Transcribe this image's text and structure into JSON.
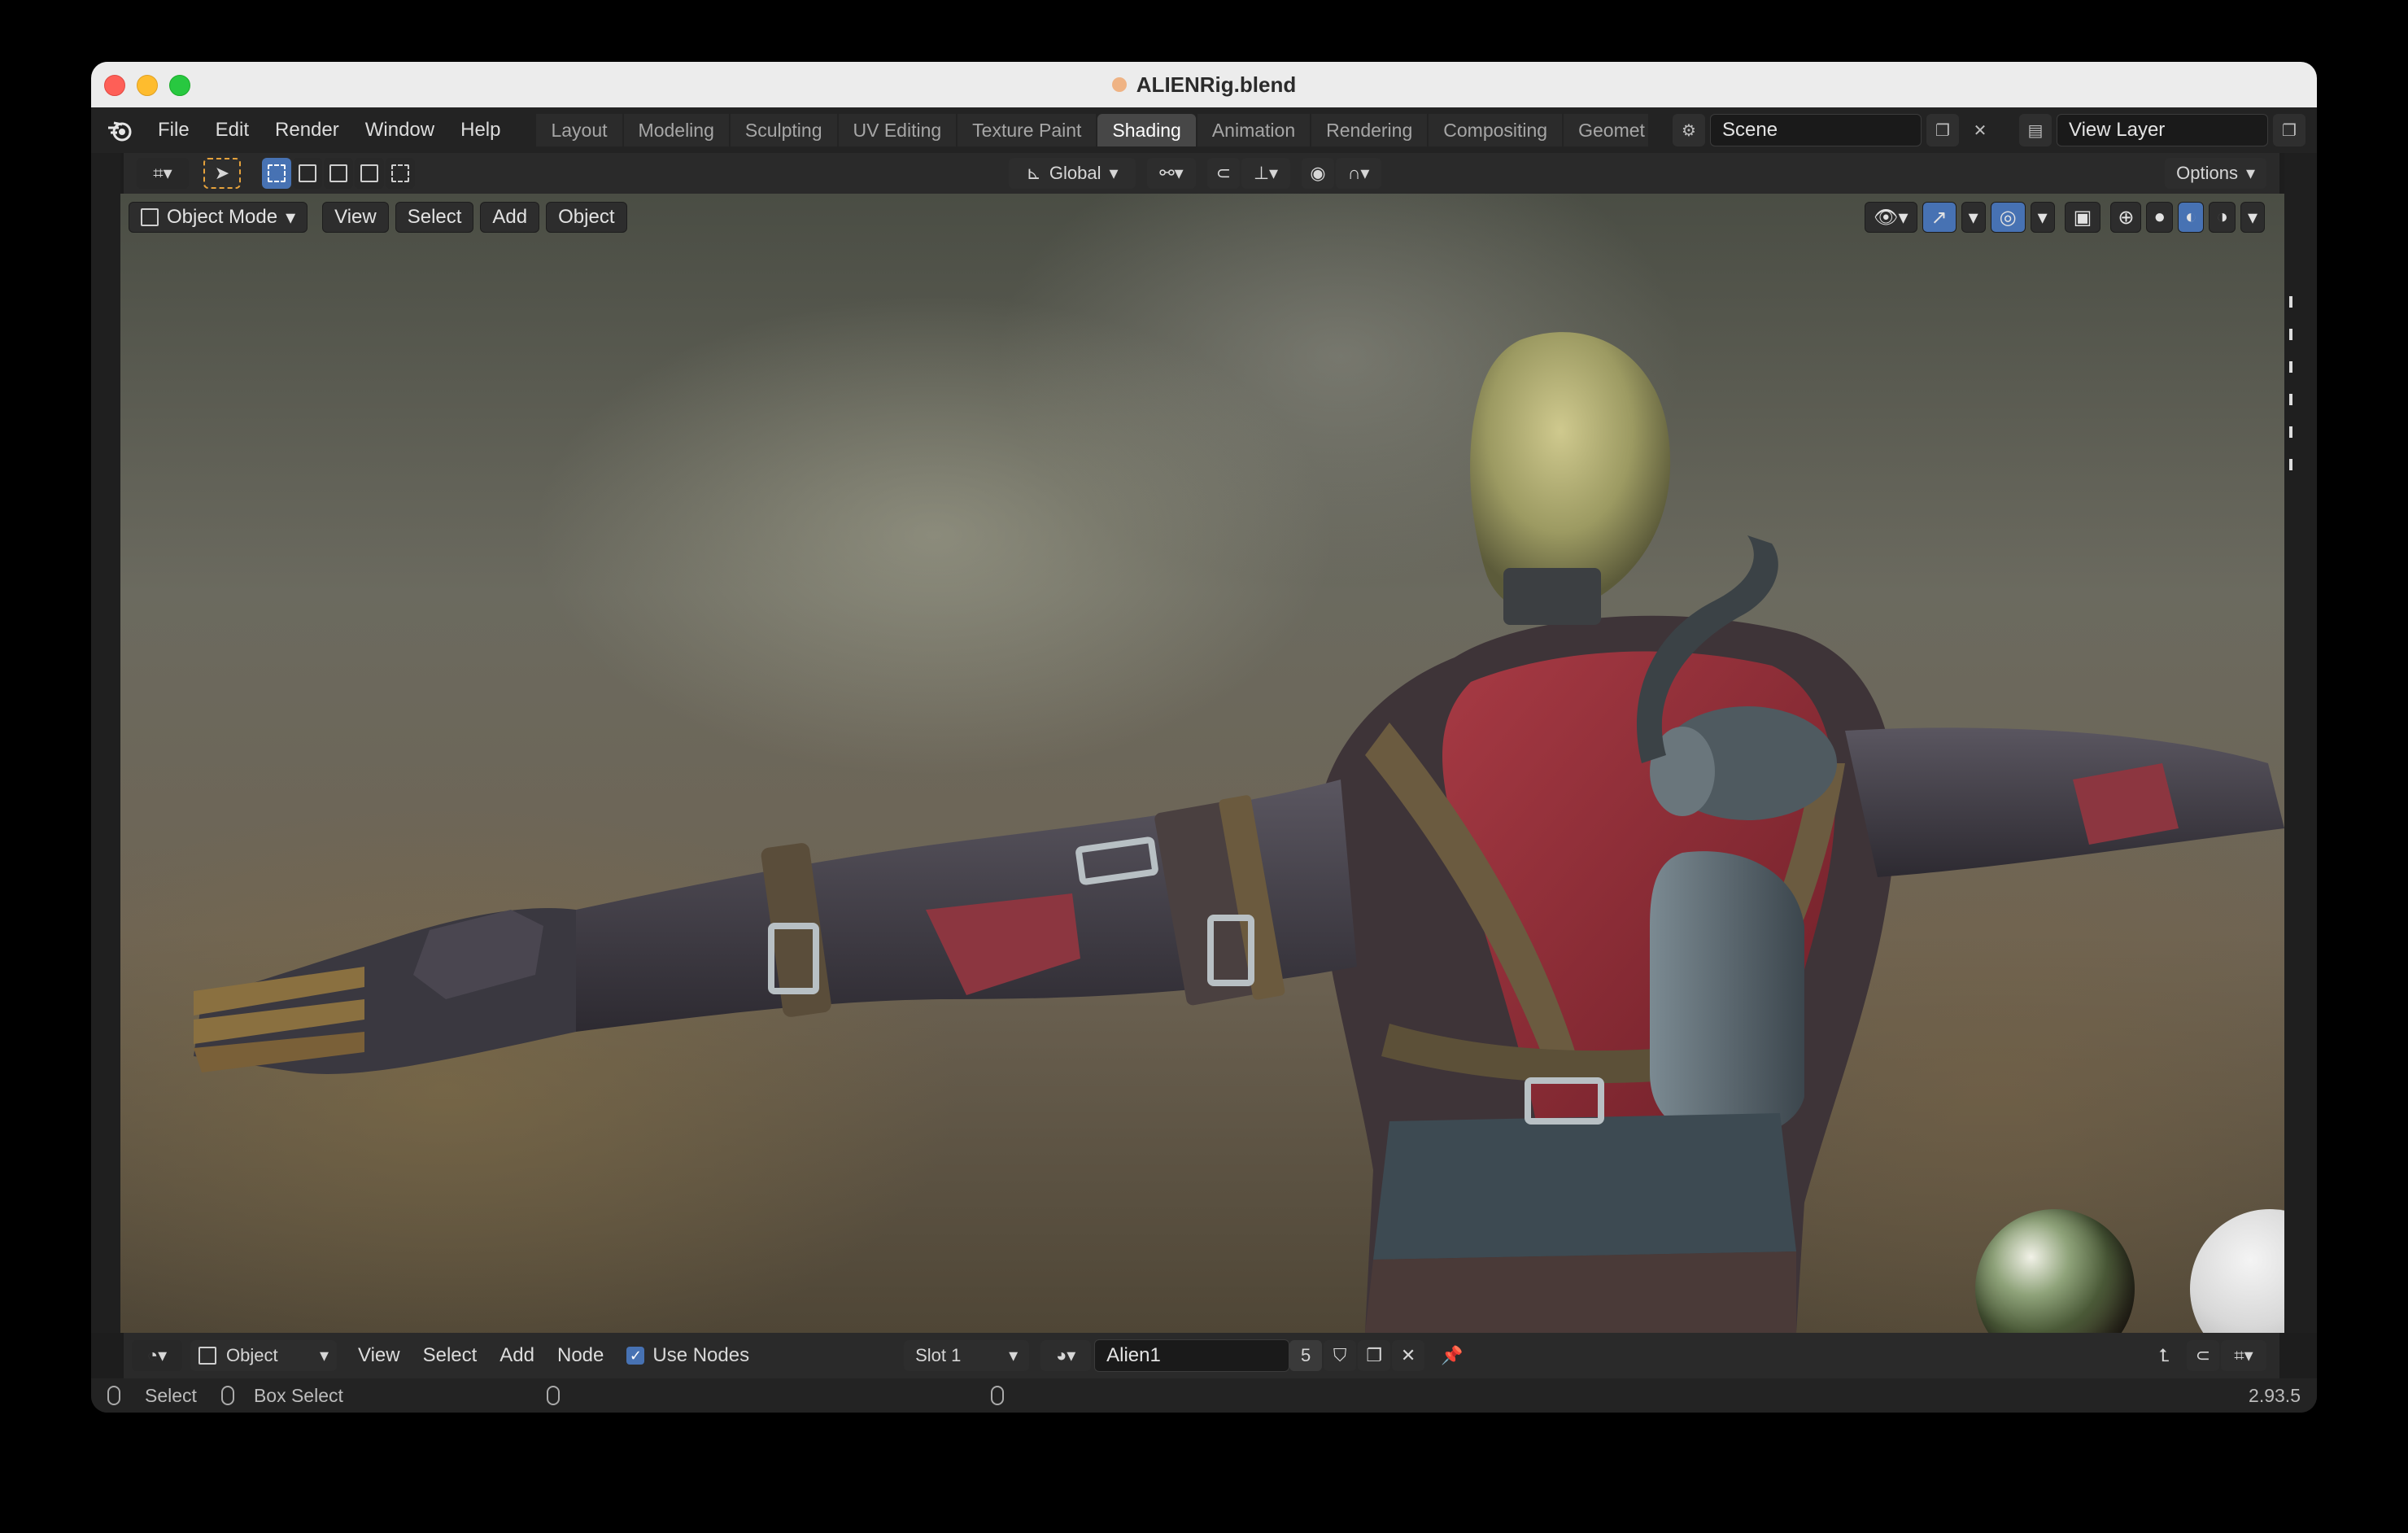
{
  "window": {
    "title": "ALIENRig.blend"
  },
  "menu": [
    "File",
    "Edit",
    "Render",
    "Window",
    "Help"
  ],
  "workspaces": {
    "tabs": [
      "Layout",
      "Modeling",
      "Sculpting",
      "UV Editing",
      "Texture Paint",
      "Shading",
      "Animation",
      "Rendering",
      "Compositing",
      "Geomet"
    ],
    "active": "Shading"
  },
  "scene": {
    "name": "Scene"
  },
  "view_layer": {
    "name": "View Layer"
  },
  "tool_header": {
    "transform_orientation": "Global",
    "options_label": "Options"
  },
  "viewport": {
    "mode": "Object Mode",
    "menus": [
      "View",
      "Select",
      "Add",
      "Object"
    ]
  },
  "node_editor": {
    "type": "Object",
    "menus": [
      "View",
      "Select",
      "Add",
      "Node"
    ],
    "use_nodes_label": "Use Nodes",
    "use_nodes_checked": true,
    "slot": "Slot 1",
    "material": "Alien1",
    "users": "5"
  },
  "statusbar": {
    "select": "Select",
    "box_select": "Box Select",
    "version": "2.93.5"
  },
  "colors": {
    "accent": "#4772b3",
    "active_tab": "#474747"
  }
}
